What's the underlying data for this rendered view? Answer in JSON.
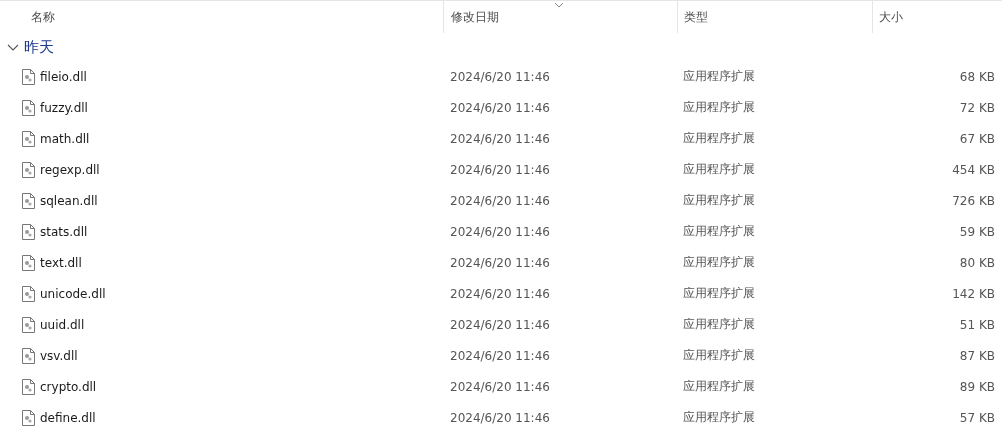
{
  "columns": [
    {
      "label": "名称",
      "sorted": false
    },
    {
      "label": "修改日期",
      "sorted": true
    },
    {
      "label": "类型",
      "sorted": false
    },
    {
      "label": "大小",
      "sorted": false
    }
  ],
  "groups": [
    {
      "label": "昨天",
      "expanded": true,
      "files": [
        {
          "name": "fileio.dll",
          "modified": "2024/6/20 11:46",
          "type": "应用程序扩展",
          "size": "68 KB"
        },
        {
          "name": "fuzzy.dll",
          "modified": "2024/6/20 11:46",
          "type": "应用程序扩展",
          "size": "72 KB"
        },
        {
          "name": "math.dll",
          "modified": "2024/6/20 11:46",
          "type": "应用程序扩展",
          "size": "67 KB"
        },
        {
          "name": "regexp.dll",
          "modified": "2024/6/20 11:46",
          "type": "应用程序扩展",
          "size": "454 KB"
        },
        {
          "name": "sqlean.dll",
          "modified": "2024/6/20 11:46",
          "type": "应用程序扩展",
          "size": "726 KB"
        },
        {
          "name": "stats.dll",
          "modified": "2024/6/20 11:46",
          "type": "应用程序扩展",
          "size": "59 KB"
        },
        {
          "name": "text.dll",
          "modified": "2024/6/20 11:46",
          "type": "应用程序扩展",
          "size": "80 KB"
        },
        {
          "name": "unicode.dll",
          "modified": "2024/6/20 11:46",
          "type": "应用程序扩展",
          "size": "142 KB"
        },
        {
          "name": "uuid.dll",
          "modified": "2024/6/20 11:46",
          "type": "应用程序扩展",
          "size": "51 KB"
        },
        {
          "name": "vsv.dll",
          "modified": "2024/6/20 11:46",
          "type": "应用程序扩展",
          "size": "87 KB"
        },
        {
          "name": "crypto.dll",
          "modified": "2024/6/20 11:46",
          "type": "应用程序扩展",
          "size": "89 KB"
        },
        {
          "name": "define.dll",
          "modified": "2024/6/20 11:46",
          "type": "应用程序扩展",
          "size": "57 KB"
        }
      ]
    }
  ]
}
